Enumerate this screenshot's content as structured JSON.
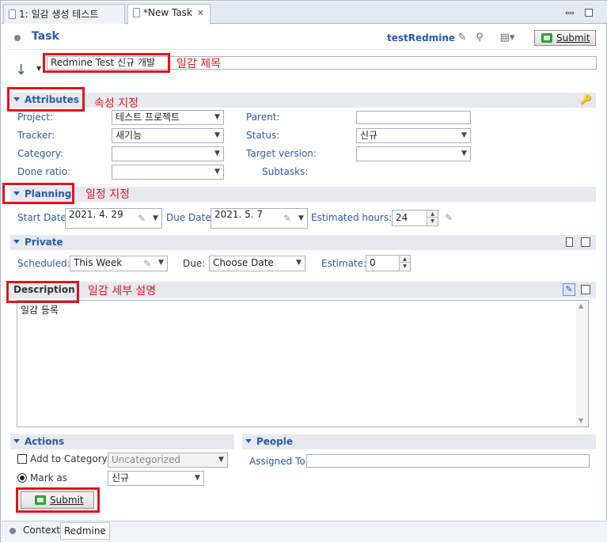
{
  "tabs": [
    {
      "label": "1: 일감 생성 테스트",
      "active": false
    },
    {
      "label": "*New Task",
      "active": true
    }
  ],
  "header": {
    "title": "Task",
    "repository": "testRedmine",
    "submit_label": "Submit"
  },
  "summary": {
    "value": "Redmine Test 신규 개발"
  },
  "sections": {
    "attributes": "Attributes",
    "planning": "Planning",
    "private": "Private",
    "description": "Description",
    "actions": "Actions",
    "people": "People"
  },
  "attributes": {
    "project": {
      "label": "Project:",
      "value": "테스트 프로젝트"
    },
    "tracker": {
      "label": "Tracker:",
      "value": "새기능"
    },
    "category": {
      "label": "Category:",
      "value": ""
    },
    "done_ratio": {
      "label": "Done ratio:",
      "value": ""
    },
    "parent": {
      "label": "Parent:",
      "value": ""
    },
    "status": {
      "label": "Status:",
      "value": "신규"
    },
    "target_version": {
      "label": "Target version:",
      "value": ""
    },
    "subtasks": {
      "label": "Subtasks:"
    }
  },
  "planning": {
    "start_date": {
      "label": "Start Date:",
      "value": "2021. 4. 29"
    },
    "due_date": {
      "label": "Due Date:",
      "value": "2021. 5. 7"
    },
    "estimated_hours": {
      "label": "Estimated hours:",
      "value": "24"
    }
  },
  "private": {
    "scheduled": {
      "label": "Scheduled:",
      "value": "This Week"
    },
    "due": {
      "label": "Due:",
      "value": "Choose Date"
    },
    "estimate": {
      "label": "Estimate:",
      "value": "0"
    }
  },
  "description": {
    "text": "일감 등록"
  },
  "actions": {
    "add_to_category": {
      "label": "Add to Category",
      "value": "Uncategorized",
      "checked": false
    },
    "mark_as": {
      "label": "Mark as",
      "value": "신규",
      "selected": true
    },
    "submit_label": "Submit"
  },
  "people": {
    "assigned_to": {
      "label": "Assigned To:",
      "value": ""
    }
  },
  "bottom_tabs": [
    {
      "label": "Context",
      "active": false
    },
    {
      "label": "Redmine",
      "active": true
    }
  ],
  "annotations": {
    "summary": "일감 제목",
    "attributes": "속성 지정",
    "planning": "일정 지정",
    "description": "일감 세부 설명"
  },
  "colors": {
    "accent": "#2a5aa8",
    "annotation": "#e0141e",
    "section_bg": "#e6e9ee"
  }
}
